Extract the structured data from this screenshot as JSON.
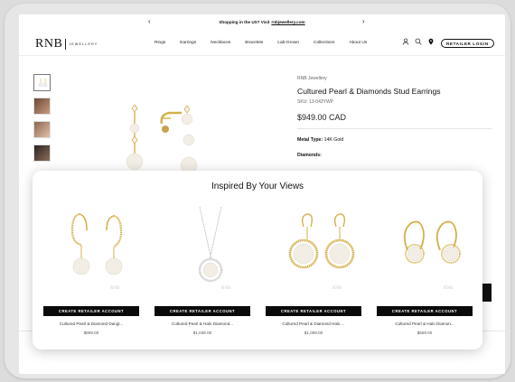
{
  "announcement": {
    "text": "Shopping in the US? Visit",
    "link": "rnbjewellery.com",
    "prev": "‹",
    "next": "›"
  },
  "header": {
    "logo_main": "RNB",
    "logo_sub": "JEWELLERY",
    "nav": [
      "Rings",
      "Earrings",
      "Necklaces",
      "Bracelets",
      "Lab-Grown",
      "Collections",
      "About Us"
    ],
    "retailer_login": "RETAILER LOGIN",
    "icons": [
      "user-icon",
      "search-icon",
      "location-pin-icon"
    ]
  },
  "product": {
    "brand": "RNB Jewellery",
    "title": "Cultured Pearl & Diamonds Stud Earrings",
    "sku": "SKU: 13-043YWP",
    "price": "$949.00 CAD",
    "metal_label": "Metal Type:",
    "metal_value": "14K Gold",
    "diamonds_label": "Diamonds:"
  },
  "inspired": {
    "heading": "Inspired By Your Views",
    "watermark": "RNB",
    "items": [
      {
        "cta": "CREATE RETAILER ACCOUNT",
        "name": "Cultured Pearl & Diamond Dangl...",
        "price": "$699.00"
      },
      {
        "cta": "CREATE RETAILER ACCOUNT",
        "name": "Cultured Pearl & Halo Diamond...",
        "price": "$1,039.00"
      },
      {
        "cta": "CREATE RETAILER ACCOUNT",
        "name": "Cultured Pearl & Diamond Halo ...",
        "price": "$1,059.00"
      },
      {
        "cta": "CREATE RETAILER ACCOUNT",
        "name": "Cultured Pearl & Halo Diamon...",
        "price": "$559.00"
      }
    ]
  },
  "colors": {
    "gold": "#d4b04a",
    "pearl": "#f2eee6",
    "black": "#0a0a0a"
  }
}
